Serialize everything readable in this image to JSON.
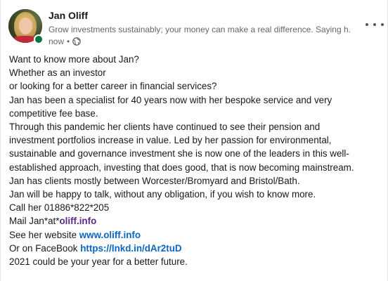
{
  "author": {
    "name": "Jan Oliff",
    "headline": "Grow investments sustainably; your money can make a real difference. Saying h...",
    "time": "now",
    "visibility_icon": "globe-icon",
    "more_icon": "ellipsis-icon"
  },
  "post": {
    "lines": [
      "Want to know more about Jan?",
      "Whether as an investor",
      "or looking for a better career in financial services?",
      "Jan has been a specialist for 40 years now with her bespoke service and very",
      "competitive fee base.",
      "Through this pandemic her clients have continued to see their pension and",
      "investment portfolios increase in value. Led by her passion for environmental,",
      "sustainable and governance investment she is now one of the leaders in this well-",
      "established approach, investing that does good, that is now becoming mainstream.",
      "Jan has clients mostly between Worcester/Bromyard and Bristol/Bath.",
      "Jan will be happy to talk, without any obligation, if you wish to know more.",
      "Call her 01886*822*205"
    ],
    "mail_prefix": "Mail Jan*at*",
    "mail_link": "oliff.info",
    "website_prefix": "See her website ",
    "website_link": "www.oliff.info",
    "facebook_prefix": "Or on FaceBook ",
    "facebook_link": "https://lnkd.in/dAr2tuD",
    "closing": "2021 could be your year for a better future."
  },
  "colors": {
    "link": "#0a66c2",
    "visited_link": "#5b2b8c",
    "online": "#057642",
    "secondary_text": "#666666"
  }
}
